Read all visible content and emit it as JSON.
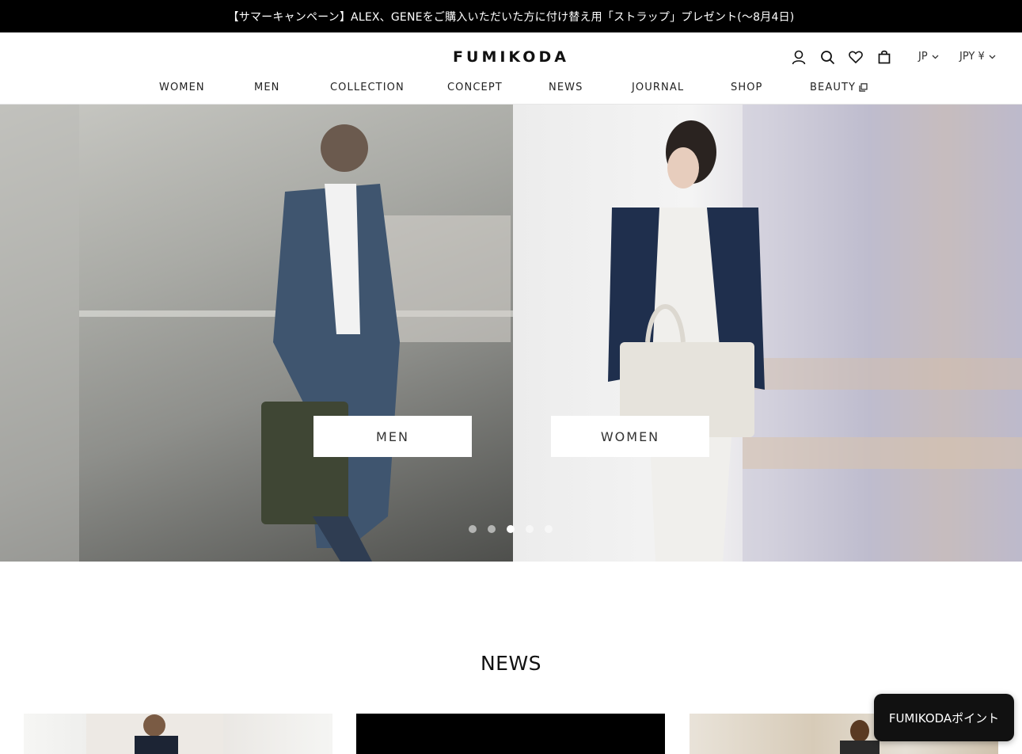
{
  "announcement": "【サマーキャンペーン】ALEX、GENEをご購入いただいた方に付け替え用「ストラップ」プレゼント(〜8月4日)",
  "header": {
    "logo": "FUMIKODA",
    "language": "JP",
    "currency": "JPY ¥",
    "icons": [
      "account-icon",
      "search-icon",
      "wishlist-heart-icon",
      "cart-bag-icon"
    ]
  },
  "nav": [
    "WOMEN",
    "MEN",
    "COLLECTION",
    "CONCEPT",
    "NEWS",
    "JOURNAL",
    "SHOP",
    "BEAUTY"
  ],
  "hero": {
    "left_button": "MEN",
    "right_button": "WOMEN",
    "slide_count": 5,
    "active_slide": 3
  },
  "news": {
    "title": "NEWS"
  },
  "points_button": "FUMIKODAポイント",
  "colors": {
    "announcement_bg": "#000000",
    "text": "#1a1a1a",
    "points_bg": "#111111"
  }
}
